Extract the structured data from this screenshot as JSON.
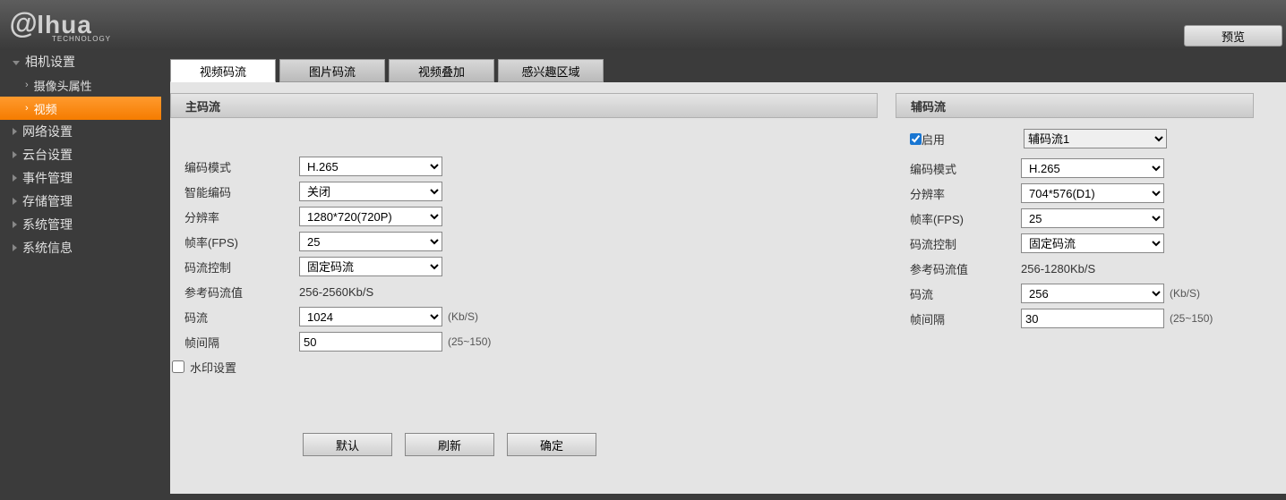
{
  "header": {
    "logo_at": "@",
    "logo_text": "lhua",
    "logo_sub": "TECHNOLOGY",
    "preview_btn": "预览"
  },
  "sidebar": {
    "items": [
      {
        "label": "相机设置",
        "type": "parent-open"
      },
      {
        "label": "摄像头属性",
        "type": "child"
      },
      {
        "label": "视频",
        "type": "child-active"
      },
      {
        "label": "网络设置",
        "type": "parent"
      },
      {
        "label": "云台设置",
        "type": "parent"
      },
      {
        "label": "事件管理",
        "type": "parent"
      },
      {
        "label": "存储管理",
        "type": "parent"
      },
      {
        "label": "系统管理",
        "type": "parent"
      },
      {
        "label": "系统信息",
        "type": "parent"
      }
    ]
  },
  "tabs": [
    {
      "label": "视频码流",
      "active": true
    },
    {
      "label": "图片码流",
      "active": false
    },
    {
      "label": "视频叠加",
      "active": false
    },
    {
      "label": "感兴趣区域",
      "active": false
    }
  ],
  "main_stream": {
    "header": "主码流",
    "encode_mode_label": "编码模式",
    "encode_mode_value": "H.265",
    "smart_codec_label": "智能编码",
    "smart_codec_value": "关闭",
    "resolution_label": "分辨率",
    "resolution_value": "1280*720(720P)",
    "fps_label": "帧率(FPS)",
    "fps_value": "25",
    "bitrate_ctrl_label": "码流控制",
    "bitrate_ctrl_value": "固定码流",
    "ref_bitrate_label": "参考码流值",
    "ref_bitrate_value": "256-2560Kb/S",
    "bitrate_label": "码流",
    "bitrate_value": "1024",
    "bitrate_suffix": "(Kb/S)",
    "iframe_label": "帧间隔",
    "iframe_value": "50",
    "iframe_suffix": "(25~150)",
    "watermark_label": "水印设置"
  },
  "sub_stream": {
    "header": "辅码流",
    "enable_label": "启用",
    "enable_checked": true,
    "stream_select": "辅码流1",
    "encode_mode_label": "编码模式",
    "encode_mode_value": "H.265",
    "resolution_label": "分辨率",
    "resolution_value": "704*576(D1)",
    "fps_label": "帧率(FPS)",
    "fps_value": "25",
    "bitrate_ctrl_label": "码流控制",
    "bitrate_ctrl_value": "固定码流",
    "ref_bitrate_label": "参考码流值",
    "ref_bitrate_value": "256-1280Kb/S",
    "bitrate_label": "码流",
    "bitrate_value": "256",
    "bitrate_suffix": "(Kb/S)",
    "iframe_label": "帧间隔",
    "iframe_value": "30",
    "iframe_suffix": "(25~150)"
  },
  "buttons": {
    "default": "默认",
    "refresh": "刷新",
    "ok": "确定"
  }
}
